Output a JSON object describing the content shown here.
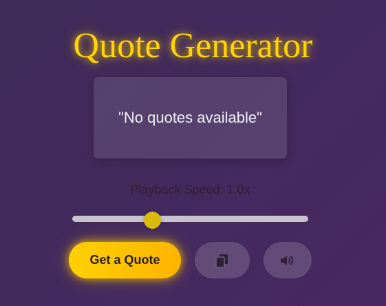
{
  "title": "Quote Generator",
  "quote": {
    "text": "\"No quotes available\""
  },
  "playback": {
    "label": "Playback Speed: 1.0x",
    "speed_value": 1.0,
    "speed_fraction": 0.34
  },
  "buttons": {
    "get_quote_label": "Get a Quote",
    "copy_icon": "copy-icon",
    "speak_icon": "speaker-icon"
  },
  "colors": {
    "accent": "#ffd400",
    "button_gradient_start": "#ffd000",
    "button_gradient_end": "#ffb400",
    "background": "#432a5e",
    "slider_thumb": "#d9bb0a",
    "slider_track": "#c8c1d0"
  }
}
